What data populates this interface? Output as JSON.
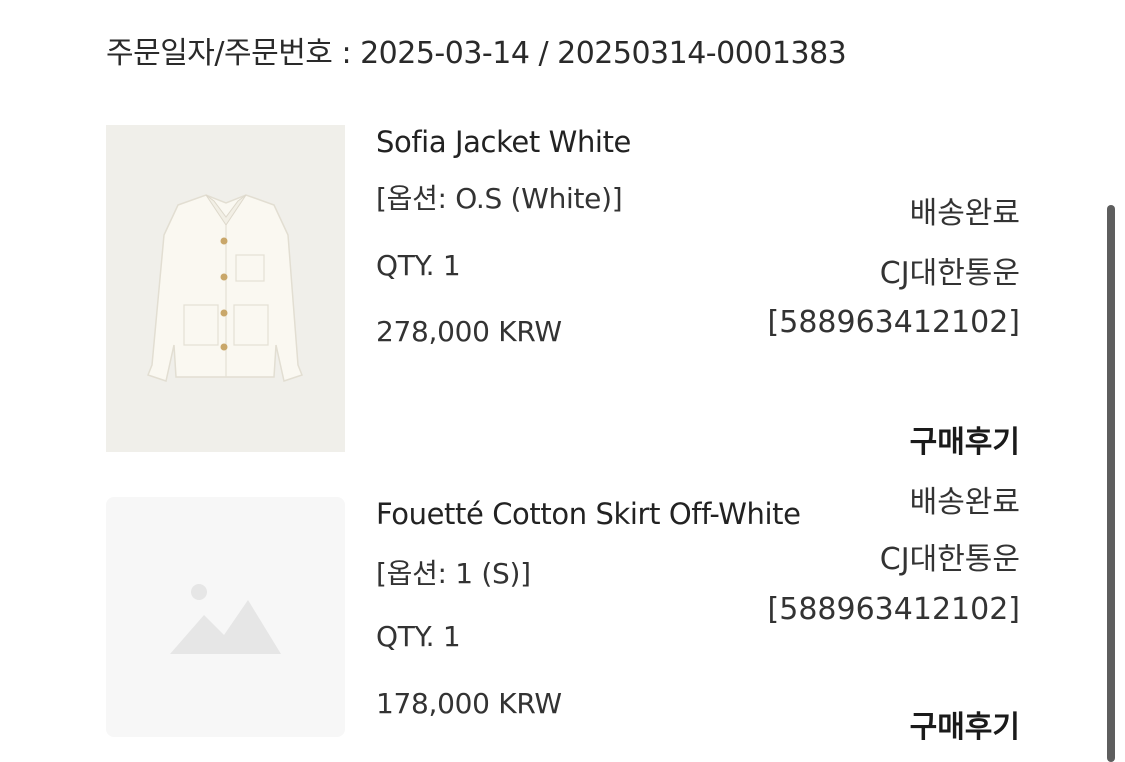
{
  "order": {
    "header": "주문일자/주문번호 : 2025-03-14 / 20250314-0001383"
  },
  "items": [
    {
      "name": "Sofia Jacket White",
      "option": "[옵션: O.S (White)]",
      "qty": "QTY. 1",
      "price": "278,000 KRW",
      "status": "배송완료",
      "courier": "CJ대한통운",
      "tracking": "[588963412102]",
      "review_label": "구매후기",
      "thumbnail": "jacket-product-photo"
    },
    {
      "name": "Fouetté Cotton Skirt Off-White",
      "option": "[옵션: 1 (S)]",
      "qty": "QTY. 1",
      "price": "178,000 KRW",
      "status": "배송완료",
      "courier": "CJ대한통운",
      "tracking": "[588963412102]",
      "review_label": "구매후기",
      "thumbnail": "image-placeholder-icon"
    }
  ],
  "colors": {
    "thumb_bg": "#f0efea",
    "placeholder_bg": "#f7f7f7",
    "placeholder_icon": "#e6e6e6",
    "scrollbar": "#5e5e5e"
  }
}
